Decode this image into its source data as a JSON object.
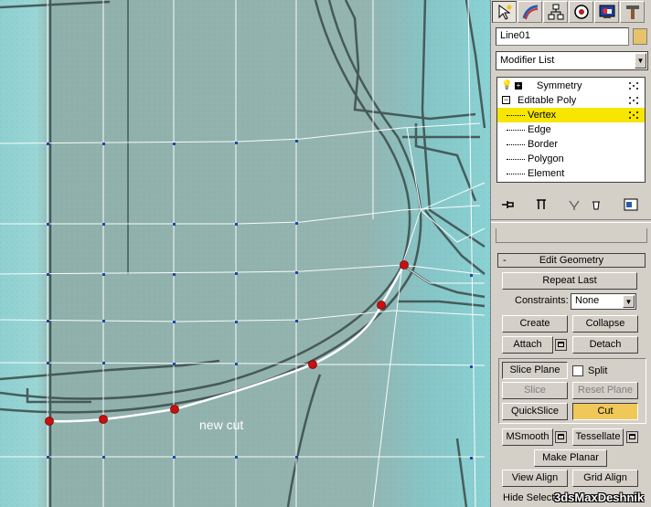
{
  "viewport": {
    "annotation": "new cut",
    "colors": {
      "cut_line": "#ffffff",
      "vertex": "#cc1111",
      "wire": "#ffffff",
      "background": "#8fb0ab"
    }
  },
  "command_panel": {
    "tabs": [
      {
        "name": "create",
        "icon": "pointer-star-icon",
        "active": true
      },
      {
        "name": "modify",
        "icon": "modify-arc-icon",
        "active": false
      },
      {
        "name": "hierarchy",
        "icon": "hierarchy-icon",
        "active": false
      },
      {
        "name": "motion",
        "icon": "motion-icon",
        "active": false
      },
      {
        "name": "display",
        "icon": "display-icon",
        "active": false
      },
      {
        "name": "utilities",
        "icon": "hammer-icon",
        "active": false
      }
    ],
    "object_name": "Line01",
    "object_color": "#e6c36a",
    "modifier_list": {
      "selected": "Modifier List"
    },
    "stack": [
      {
        "label": "Symmetry",
        "icon": "lightbulb-icon",
        "expand": "+"
      },
      {
        "label": "Editable Poly",
        "expand": "−"
      },
      {
        "label": "Vertex",
        "selected": true
      },
      {
        "label": "Edge"
      },
      {
        "label": "Border"
      },
      {
        "label": "Polygon"
      },
      {
        "label": "Element"
      }
    ],
    "edit_geometry": {
      "title": "Edit Geometry",
      "collapse_sign": "-",
      "repeat_last": "Repeat Last",
      "constraints_label": "Constraints:",
      "constraints_value": "None",
      "create": "Create",
      "collapse": "Collapse",
      "attach": "Attach",
      "detach": "Detach",
      "slice_plane": "Slice Plane",
      "split": "Split",
      "slice": "Slice",
      "reset_plane": "Reset Plane",
      "quickslice": "QuickSlice",
      "cut": "Cut",
      "msmooth": "MSmooth",
      "tessellate": "Tessellate",
      "make_planar": "Make Planar",
      "view_align": "View Align",
      "grid_align": "Grid Align",
      "hide_selected": "Hide Selecte"
    }
  },
  "watermark": "3dsMaxDeshnik"
}
